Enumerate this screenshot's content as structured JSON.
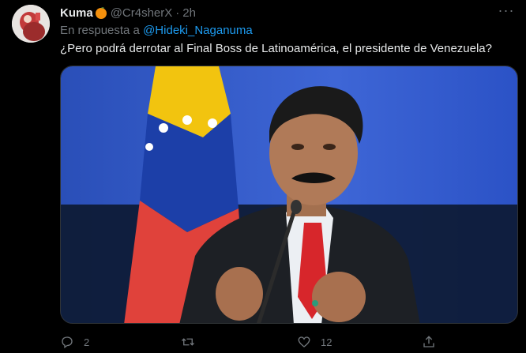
{
  "tweet": {
    "author_name": "Kuma",
    "author_handle": "@Cr4sherX",
    "separator": "·",
    "time": "2h",
    "reply_prefix": "En respuesta a",
    "reply_mention": "@Hideki_Naganuma",
    "text": "¿Pero podrá derrotar al Final Boss de Latinoamérica, el presidente de Venezuela?",
    "more_label": "···",
    "actions": {
      "reply_count": "2",
      "retweet_count": "",
      "like_count": "12"
    }
  },
  "colors": {
    "background": "#000000",
    "text_primary": "#e7e9ea",
    "text_secondary": "#71767b",
    "link": "#1d9bf0"
  },
  "icons": [
    "orange-emoji-icon",
    "more-options-icon",
    "reply-icon",
    "retweet-icon",
    "like-icon",
    "share-icon"
  ]
}
